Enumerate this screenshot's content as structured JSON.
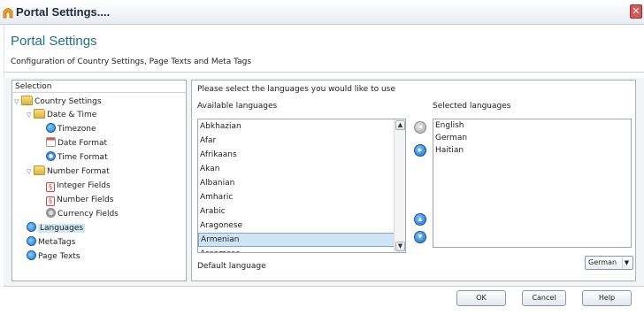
{
  "window": {
    "title": "Portal Settings....",
    "close_glyph": "✕"
  },
  "header": {
    "title": "Portal Settings",
    "subtitle": "Configuration of Country Settings, Page Texts and Meta Tags"
  },
  "selection": {
    "header": "Selection",
    "tree": {
      "country_settings": "Country Settings",
      "date_time": "Date & Time",
      "timezone": "Timezone",
      "date_format": "Date Format",
      "time_format": "Time Format",
      "number_format": "Number Format",
      "integer_fields": "Integer Fields",
      "number_fields": "Number Fields",
      "currency_fields": "Currency Fields",
      "languages": "Languages",
      "metatags": "MetaTags",
      "page_texts": "Page Texts"
    }
  },
  "languages": {
    "instruction": "Please select the languages you would like to use",
    "available_label": "Available languages",
    "selected_label": "Selected languages",
    "available": [
      "Abkhazian",
      "Afar",
      "Afrikaans",
      "Akan",
      "Albanian",
      "Amharic",
      "Arabic",
      "Aragonese",
      "Armenian",
      "Assamese"
    ],
    "highlighted_index": 8,
    "selected": [
      "English",
      "German",
      "Haitian"
    ],
    "default_label": "Default language",
    "default_value": "German"
  },
  "footer": {
    "ok": "OK",
    "cancel": "Cancel",
    "help": "Help"
  },
  "colors": {
    "title_accent": "#1e6f8f",
    "highlight": "#cfe4f6",
    "button_blue": "#1f6fc4"
  }
}
